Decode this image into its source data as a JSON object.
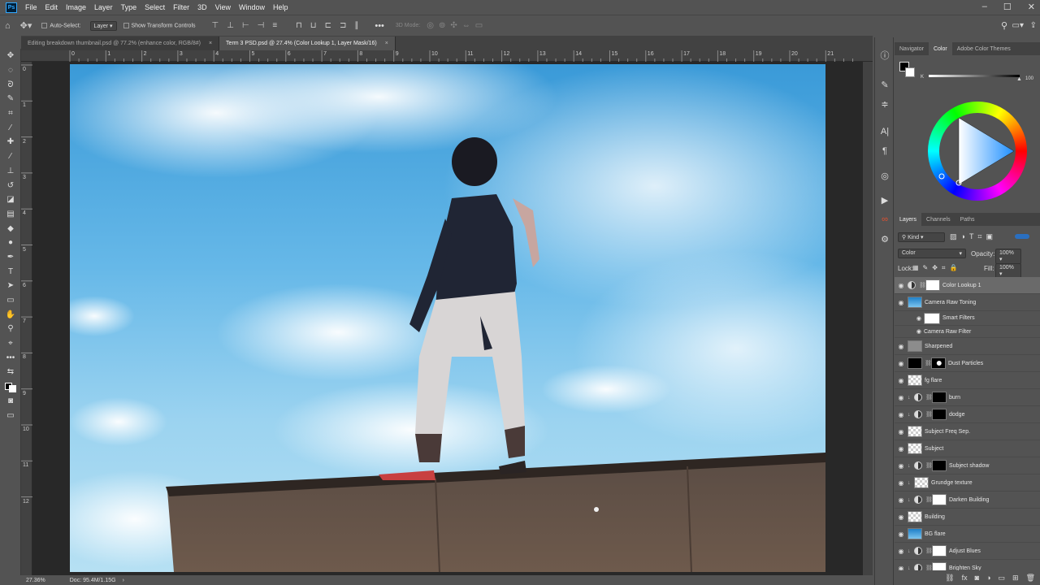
{
  "menu": [
    "File",
    "Edit",
    "Image",
    "Layer",
    "Type",
    "Select",
    "Filter",
    "3D",
    "View",
    "Window",
    "Help"
  ],
  "ps_logo": "Ps",
  "options": {
    "auto_select": "Auto-Select:",
    "auto_select_value": "Layer",
    "show_transform": "Show Transform Controls",
    "mode_3d": "3D Mode:"
  },
  "tabs": [
    {
      "label": "Editing breakdown thumbnail.psd @ 77.2% (enhance color, RGB/8#)",
      "active": false
    },
    {
      "label": "Term 3 PSD.psd @ 27.4% (Color Lookup 1, Layer Mask/16)",
      "active": true
    }
  ],
  "ruler_h": [
    "0",
    "1",
    "2",
    "3",
    "4",
    "5",
    "6",
    "7",
    "8",
    "9",
    "10",
    "11",
    "12",
    "13",
    "14",
    "15",
    "16",
    "17",
    "18",
    "19",
    "20",
    "21"
  ],
  "ruler_v": [
    "0",
    "1",
    "2",
    "3",
    "4",
    "5",
    "6",
    "7",
    "8",
    "9",
    "10",
    "11",
    "12"
  ],
  "status": {
    "zoom": "27.36%",
    "doc": "Doc: 95.4M/1.15G"
  },
  "color_panel": {
    "tabs": [
      "Navigator",
      "Color",
      "Adobe Color Themes"
    ],
    "active_tab": "Color",
    "channel": "K",
    "value": "100"
  },
  "layers_panel": {
    "tabs": [
      "Layers",
      "Channels",
      "Paths"
    ],
    "filter_kind": "Kind",
    "blend_mode": "Color",
    "opacity_label": "Opacity:",
    "opacity": "100%",
    "lock_label": "Lock:",
    "fill_label": "Fill:",
    "fill": "100%",
    "layers": [
      {
        "name": "Color Lookup 1",
        "thumb": "adj-white",
        "selected": true
      },
      {
        "name": "Camera Raw Toning",
        "thumb": "sky"
      },
      {
        "name": "Smart Filters",
        "thumb": "white",
        "indent": true
      },
      {
        "name": "Camera Raw Filter",
        "thumb": "none",
        "indent": true
      },
      {
        "name": "Sharpened",
        "thumb": "gray"
      },
      {
        "name": "Dust Particles",
        "thumb": "black-mask"
      },
      {
        "name": "fg flare",
        "thumb": "checker"
      },
      {
        "name": "burn",
        "thumb": "black"
      },
      {
        "name": "dodge",
        "thumb": "black"
      },
      {
        "name": "Subject Freq Sep.",
        "thumb": "checker"
      },
      {
        "name": "Subject",
        "thumb": "checker"
      },
      {
        "name": "Subject shadow",
        "thumb": "black"
      },
      {
        "name": "Grundge texture",
        "thumb": "checker"
      },
      {
        "name": "Darken Building",
        "thumb": "white"
      },
      {
        "name": "Building",
        "thumb": "checker"
      },
      {
        "name": "BG flare",
        "thumb": "sky"
      },
      {
        "name": "Adjust Blues",
        "thumb": "white"
      },
      {
        "name": "Brighten Sky",
        "thumb": "white"
      }
    ]
  }
}
